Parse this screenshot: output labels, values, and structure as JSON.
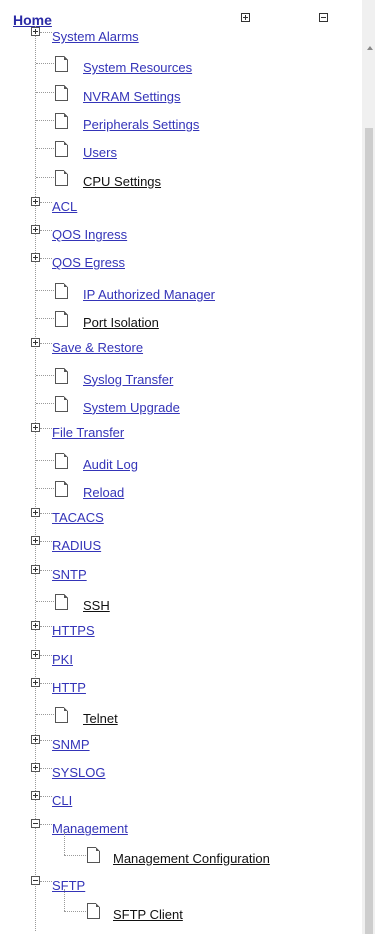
{
  "home": {
    "label": "Home"
  },
  "tree": [
    {
      "label": "System Alarms",
      "type": "folder",
      "state": "plus",
      "color": "link"
    },
    {
      "label": "System Resources",
      "type": "page",
      "color": "link"
    },
    {
      "label": "NVRAM Settings",
      "type": "page",
      "color": "link"
    },
    {
      "label": "Peripherals Settings",
      "type": "page",
      "color": "link"
    },
    {
      "label": "Users",
      "type": "page",
      "color": "link"
    },
    {
      "label": "CPU Settings",
      "type": "page",
      "color": "dark"
    },
    {
      "label": "ACL",
      "type": "folder",
      "state": "plus",
      "color": "link"
    },
    {
      "label": "QOS Ingress",
      "type": "folder",
      "state": "plus",
      "color": "link"
    },
    {
      "label": "QOS Egress",
      "type": "folder",
      "state": "plus",
      "color": "link"
    },
    {
      "label": "IP Authorized Manager",
      "type": "page",
      "color": "link"
    },
    {
      "label": "Port Isolation",
      "type": "page",
      "color": "dark"
    },
    {
      "label": "Save & Restore",
      "type": "folder",
      "state": "plus",
      "color": "link"
    },
    {
      "label": "Syslog Transfer",
      "type": "page",
      "color": "link"
    },
    {
      "label": "System Upgrade",
      "type": "page",
      "color": "link"
    },
    {
      "label": "File Transfer",
      "type": "folder",
      "state": "plus",
      "color": "link"
    },
    {
      "label": "Audit Log",
      "type": "page",
      "color": "link"
    },
    {
      "label": "Reload",
      "type": "page",
      "color": "link"
    },
    {
      "label": "TACACS",
      "type": "folder",
      "state": "plus",
      "color": "link"
    },
    {
      "label": "RADIUS",
      "type": "folder",
      "state": "plus",
      "color": "link"
    },
    {
      "label": "SNTP",
      "type": "folder",
      "state": "plus",
      "color": "link"
    },
    {
      "label": "SSH",
      "type": "page",
      "color": "dark"
    },
    {
      "label": "HTTPS",
      "type": "folder",
      "state": "plus",
      "color": "link"
    },
    {
      "label": "PKI",
      "type": "folder",
      "state": "plus",
      "color": "link"
    },
    {
      "label": "HTTP",
      "type": "folder",
      "state": "plus",
      "color": "link"
    },
    {
      "label": "Telnet",
      "type": "page",
      "color": "dark"
    },
    {
      "label": "SNMP",
      "type": "folder",
      "state": "plus",
      "color": "link"
    },
    {
      "label": "SYSLOG",
      "type": "folder",
      "state": "plus",
      "color": "link"
    },
    {
      "label": "CLI",
      "type": "folder",
      "state": "plus",
      "color": "link"
    },
    {
      "label": "Management",
      "type": "folder",
      "state": "minus",
      "color": "link"
    },
    {
      "label": "Management Configuration",
      "type": "subpage",
      "color": "dark"
    },
    {
      "label": "SFTP",
      "type": "folder",
      "state": "minus",
      "color": "link"
    },
    {
      "label": "SFTP Client",
      "type": "subpage",
      "color": "dark"
    }
  ]
}
